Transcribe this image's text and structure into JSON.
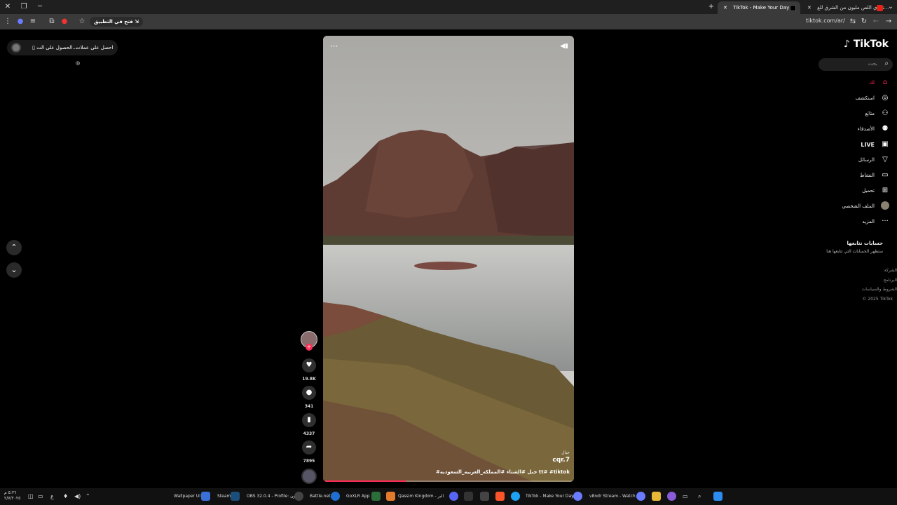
{
  "browser": {
    "tabs": [
      {
        "title": "TikTok - Make Your Day",
        "active": true
      },
      {
        "title": "تحدي اللص مليون من الشرق للغ...",
        "active": false
      }
    ],
    "open_in_app": "فتح في التطبيق",
    "url": "tiktok.com/ar/"
  },
  "top_left": {
    "get_coins": "احصل على عملات",
    "get_app": "الحصول على الت..."
  },
  "sidebar": {
    "logo": "TikTok",
    "search_placeholder": "بحث",
    "items": [
      {
        "label": "لك",
        "icon": "home-icon",
        "active": true
      },
      {
        "label": "استكشف",
        "icon": "compass-icon"
      },
      {
        "label": "متابَع",
        "icon": "user-follow-icon"
      },
      {
        "label": "الأصدقاء",
        "icon": "friends-icon"
      },
      {
        "label": "LIVE",
        "icon": "live-icon"
      },
      {
        "label": "الرسائل",
        "icon": "messages-icon"
      },
      {
        "label": "النشاط",
        "icon": "activity-icon"
      },
      {
        "label": "تحميل",
        "icon": "upload-icon"
      },
      {
        "label": "الملف الشخصي",
        "icon": "profile-avatar"
      },
      {
        "label": "المزيد",
        "icon": "more-icon"
      }
    ],
    "following_heading": "حسابات تتابعها",
    "following_sub": "ستظهر الحسابات التي تتابعها هنا",
    "footer": [
      "الشركة",
      "البرنامج",
      "الشروط والسياسات",
      "© 2025 TikTok"
    ]
  },
  "video": {
    "effect_label": "جبال",
    "author": "cqr.7",
    "caption": "#جبل #الشتاء #المملكه_العربيه_السعوديه tt# #tiktok",
    "progress": 0.33
  },
  "actions": {
    "likes": "19.8K",
    "comments": "341",
    "saves": "4337",
    "shares": "7895"
  },
  "taskbar": {
    "clock_time": "٥:٣٦ م",
    "clock_date": "٢/٧/٢٠٢٥",
    "lang": "ع",
    "items": [
      "Wallpaper UI",
      "Steam",
      "OBS 32.0.4 - Profile: بدون",
      "Battle.net",
      "GoXLR App",
      "Qassim Kingdom - البر",
      "TikTok - Make Your Day",
      "v8ndr Stream - Watch L"
    ]
  },
  "colors": {
    "accent": "#fe2c55",
    "background": "#000000"
  }
}
